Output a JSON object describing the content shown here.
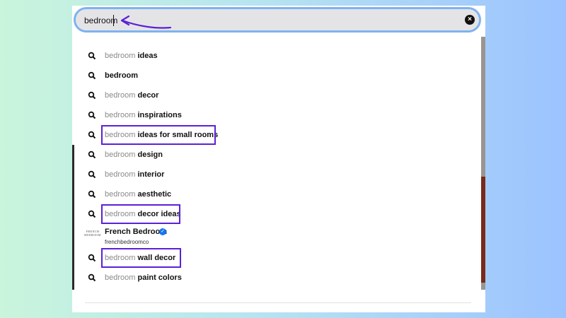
{
  "search": {
    "value": "bedroom",
    "clear_icon": "close-icon"
  },
  "suggestions": [
    {
      "query": "bedroom",
      "rest": " ideas"
    },
    {
      "query": "",
      "rest": "bedroom"
    },
    {
      "query": "bedroom",
      "rest": " decor"
    },
    {
      "query": "bedroom",
      "rest": " inspirations"
    },
    {
      "query": "bedroom",
      "rest": " ideas for small rooms"
    },
    {
      "query": "bedroom",
      "rest": " design"
    },
    {
      "query": "bedroom",
      "rest": " interior"
    },
    {
      "query": "bedroom",
      "rest": " aesthetic"
    },
    {
      "query": "bedroom",
      "rest": " decor ideas"
    },
    {
      "query": "bedroom",
      "rest": " wall decor"
    },
    {
      "query": "bedroom",
      "rest": " paint colors"
    }
  ],
  "profile": {
    "name": "French Bedroom",
    "handle": "frenchbedroomco",
    "logo_line1": "FRENCH",
    "logo_line2": "BEDROOM",
    "verified_icon": "verified-badge-icon"
  },
  "colors": {
    "highlight": "#5b21d6",
    "arrow": "#5b21d6",
    "search_border": "#7fb2f0"
  }
}
